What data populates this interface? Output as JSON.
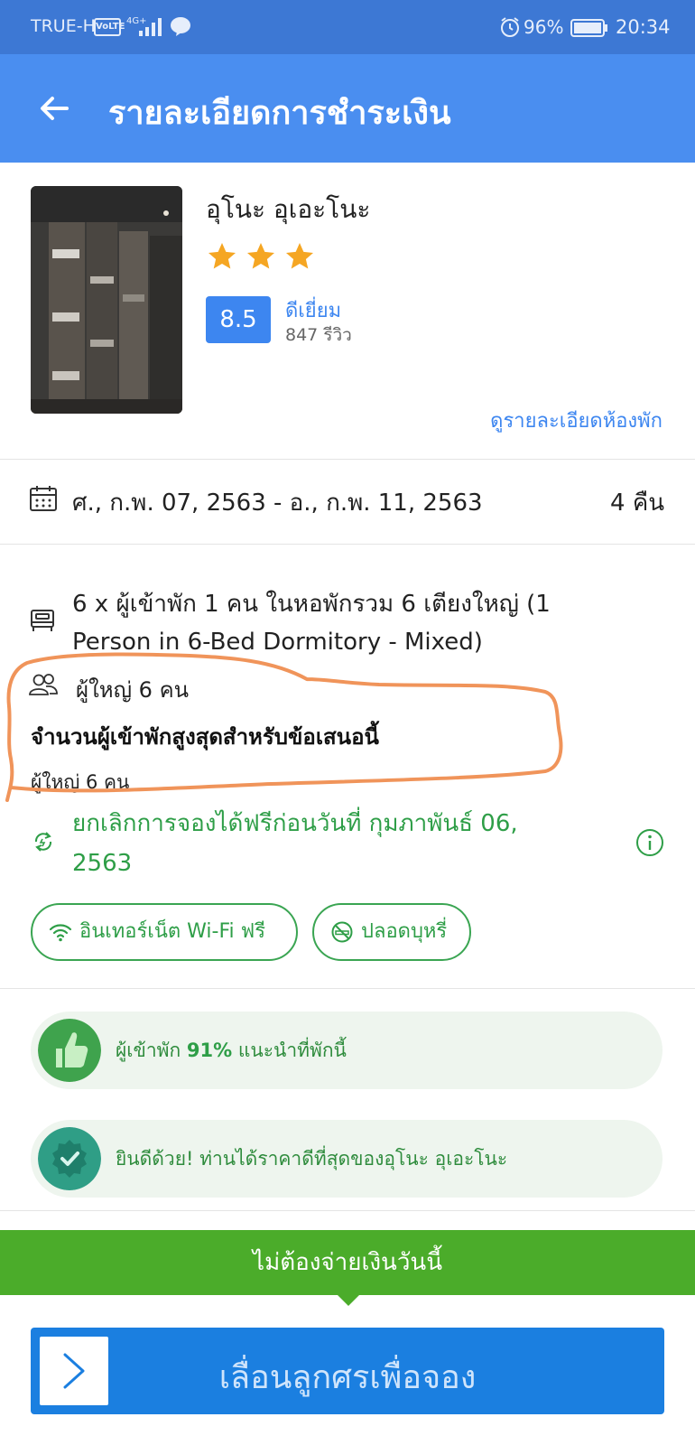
{
  "status_bar": {
    "carrier": "TRUE-H",
    "volte": "VoLTE",
    "network": "4G+",
    "battery_percent": "96%",
    "time": "20:34",
    "icons": [
      "signal-icon",
      "line-app-icon",
      "alarm-icon",
      "battery-icon"
    ]
  },
  "header": {
    "title": "รายละเอียดการชำระเงิน",
    "back_icon": "back-arrow-icon"
  },
  "hotel": {
    "name": "อุโนะ อุเอะโนะ",
    "stars": 3,
    "score": "8.5",
    "score_label": "ดีเยี่ยม",
    "reviews": "847 รีวิว",
    "room_details_link": "ดูรายละเอียดห้องพัก"
  },
  "stay": {
    "date_range": "ศ., ก.พ. 07, 2563 - อ., ก.พ. 11, 2563",
    "nights": "4 คืน"
  },
  "room": {
    "description": "6 x ผู้เข้าพัก 1 คน ในหอพักรวม 6 เตียงใหญ่ (1 Person in 6-Bed Dormitory - Mixed)",
    "adults": "ผู้ใหญ่ 6 คน",
    "max_occupancy_title": "จำนวนผู้เข้าพักสูงสุดสำหรับข้อเสนอนี้",
    "max_occupancy_value": "ผู้ใหญ่ 6 คน",
    "free_cancellation": "ยกเลิกการจองได้ฟรีก่อนวันที่ กุมภาพันธ์ 06, 2563"
  },
  "amenities": [
    {
      "label": "อินเทอร์เน็ต Wi-Fi ฟรี",
      "icon": "wifi-icon"
    },
    {
      "label": "ปลอดบุหรี่",
      "icon": "no-smoking-icon"
    }
  ],
  "banners": {
    "recommend_prefix": "ผู้เข้าพัก ",
    "recommend_percent": "91%",
    "recommend_suffix": " แนะนำที่พักนี้",
    "best_price": "ยินดีด้วย! ท่านได้ราคาดีที่สุดของอุโนะ อุเอะโนะ"
  },
  "footer": {
    "pay_later": "ไม่ต้องจ่ายเงินวันนี้",
    "slide_to_book": "เลื่อนลูกศรเพื่อจอง"
  },
  "colors": {
    "status_bar": "#3d78d4",
    "app_bar": "#4a8ef0",
    "link_blue": "#3d86f0",
    "green": "#2e9e47",
    "pay_later_green": "#4bac2a",
    "slider_blue": "#1b7fe0",
    "star": "#f5a623",
    "annotation_orange": "#f0945a"
  }
}
